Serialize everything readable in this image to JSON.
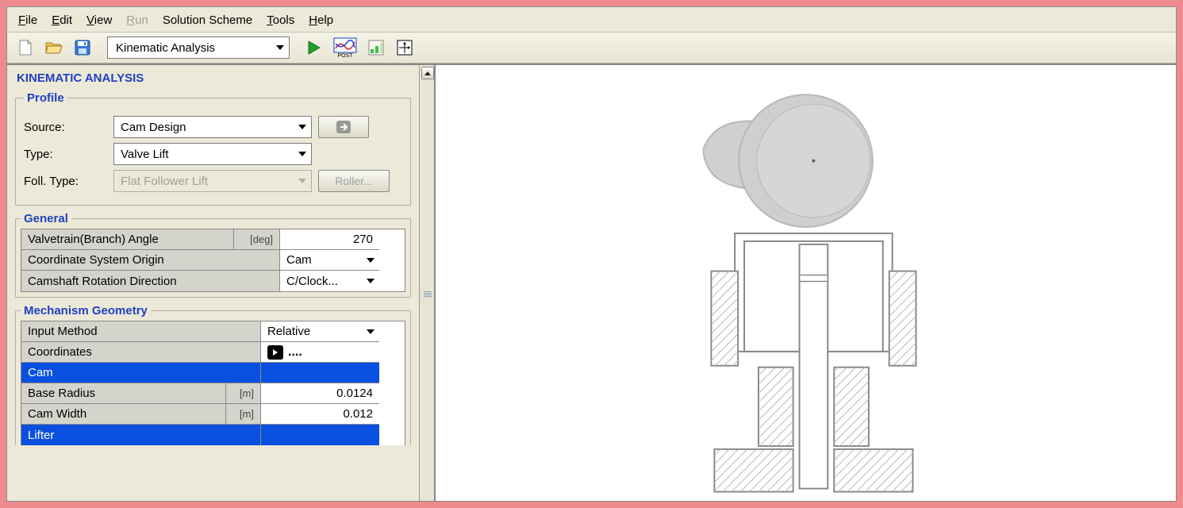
{
  "menubar": {
    "file": "File",
    "edit": "Edit",
    "view": "View",
    "run": "Run",
    "scheme": "Solution Scheme",
    "tools": "Tools",
    "help": "Help"
  },
  "toolbar": {
    "analysis_mode": "Kinematic Analysis",
    "post_label": "POST"
  },
  "panel": {
    "title": "KINEMATIC ANALYSIS",
    "profile": {
      "legend": "Profile",
      "source_label": "Source:",
      "source_value": "Cam Design",
      "type_label": "Type:",
      "type_value": "Valve Lift",
      "foll_label": "Foll. Type:",
      "foll_value": "Flat Follower Lift",
      "roller_btn": "Roller..."
    },
    "general": {
      "legend": "General",
      "branch_angle_label": "Valvetrain(Branch) Angle",
      "branch_angle_unit": "[deg]",
      "branch_angle_value": "270",
      "coord_origin_label": "Coordinate System Origin",
      "coord_origin_value": "Cam",
      "cam_rot_label": "Camshaft Rotation Direction",
      "cam_rot_value": "C/Clock..."
    },
    "mech": {
      "legend": "Mechanism Geometry",
      "input_method_label": "Input Method",
      "input_method_value": "Relative",
      "coords_label": "Coordinates",
      "coords_value": "....",
      "cam_header": "Cam",
      "base_radius_label": "Base Radius",
      "base_radius_unit": "[m]",
      "base_radius_value": "0.0124",
      "cam_width_label": "Cam Width",
      "cam_width_unit": "[m]",
      "cam_width_value": "0.012",
      "lifter_header": "Lifter"
    }
  }
}
